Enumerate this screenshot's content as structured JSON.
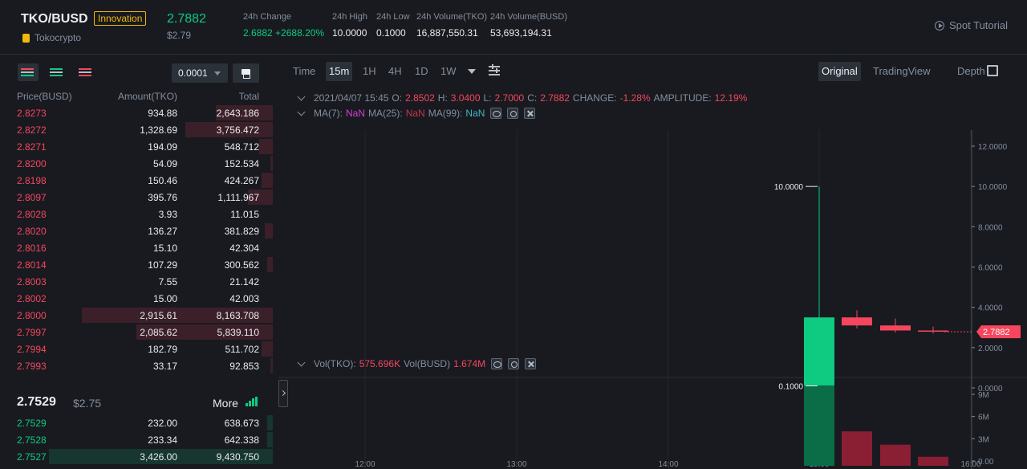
{
  "header": {
    "pair": "TKO/BUSD",
    "badge": "Innovation",
    "brand": "Tokocrypto",
    "last_price": "2.7882",
    "last_price_usd": "$2.79",
    "stats": [
      {
        "label": "24h Change",
        "value": "2.6882 +2688.20%",
        "color": "green"
      },
      {
        "label": "24h High",
        "value": "10.0000"
      },
      {
        "label": "24h Low",
        "value": "0.1000"
      },
      {
        "label": "24h Volume(TKO)",
        "value": "16,887,550.31"
      },
      {
        "label": "24h Volume(BUSD)",
        "value": "53,693,194.31"
      }
    ],
    "tutorial": "Spot Tutorial"
  },
  "orderbook": {
    "tick_size": "0.0001",
    "columns": {
      "price": "Price(BUSD)",
      "amount": "Amount(TKO)",
      "total": "Total"
    },
    "asks": [
      {
        "price": "2.8273",
        "amount": "934.88",
        "total": "2,643.186",
        "depth": 0.21
      },
      {
        "price": "2.8272",
        "amount": "1,328.69",
        "total": "3,756.472",
        "depth": 0.32
      },
      {
        "price": "2.8271",
        "amount": "194.09",
        "total": "548.712",
        "depth": 0.05
      },
      {
        "price": "2.8200",
        "amount": "54.09",
        "total": "152.534",
        "depth": 0.01
      },
      {
        "price": "2.8198",
        "amount": "150.46",
        "total": "424.267",
        "depth": 0.04
      },
      {
        "price": "2.8097",
        "amount": "395.76",
        "total": "1,111.967",
        "depth": 0.09
      },
      {
        "price": "2.8028",
        "amount": "3.93",
        "total": "11.015",
        "depth": 0.0
      },
      {
        "price": "2.8020",
        "amount": "136.27",
        "total": "381.829",
        "depth": 0.03
      },
      {
        "price": "2.8016",
        "amount": "15.10",
        "total": "42.304",
        "depth": 0.0
      },
      {
        "price": "2.8014",
        "amount": "107.29",
        "total": "300.562",
        "depth": 0.02
      },
      {
        "price": "2.8003",
        "amount": "7.55",
        "total": "21.142",
        "depth": 0.0
      },
      {
        "price": "2.8002",
        "amount": "15.00",
        "total": "42.003",
        "depth": 0.0
      },
      {
        "price": "2.8000",
        "amount": "2,915.61",
        "total": "8,163.708",
        "depth": 0.7
      },
      {
        "price": "2.7997",
        "amount": "2,085.62",
        "total": "5,839.110",
        "depth": 0.5
      },
      {
        "price": "2.7994",
        "amount": "182.79",
        "total": "511.702",
        "depth": 0.04
      },
      {
        "price": "2.7993",
        "amount": "33.17",
        "total": "92.853",
        "depth": 0.01
      }
    ],
    "mid_price": "2.7529",
    "mid_price_usd": "$2.75",
    "more": "More",
    "bids": [
      {
        "price": "2.7529",
        "amount": "232.00",
        "total": "638.673",
        "depth": 0.02
      },
      {
        "price": "2.7528",
        "amount": "233.34",
        "total": "642.338",
        "depth": 0.02
      },
      {
        "price": "2.7527",
        "amount": "3,426.00",
        "total": "9,430.750",
        "depth": 0.82
      }
    ]
  },
  "chart_toolbar": {
    "intervals": [
      "Time",
      "15m",
      "1H",
      "4H",
      "1D",
      "1W"
    ],
    "active_interval": "15m",
    "views": [
      "Original",
      "TradingView",
      "Depth"
    ],
    "active_view": "Original"
  },
  "legend": {
    "date": "2021/04/07 15:45",
    "open_label": "O:",
    "open": "2.8502",
    "high_label": "H:",
    "high": "3.0400",
    "low_label": "L:",
    "low": "2.7000",
    "close_label": "C:",
    "close": "2.7882",
    "change_label": "CHANGE:",
    "change": "-1.28%",
    "amplitude_label": "AMPLITUDE:",
    "amplitude": "12.19%",
    "ma7_label": "MA(7):",
    "ma7": "NaN",
    "ma25_label": "MA(25):",
    "ma25": "NaN",
    "ma99_label": "MA(99):",
    "ma99": "NaN",
    "vol_tko_label": "Vol(TKO):",
    "vol_tko": "575.696K",
    "vol_busd_label": "Vol(BUSD)",
    "vol_busd": "1.674M"
  },
  "chart_data": {
    "type": "candlestick",
    "price_axis": {
      "ticks": [
        "12.0000",
        "10.0000",
        "8.0000",
        "6.0000",
        "4.0000",
        "2.0000",
        "0.0000"
      ],
      "range": [
        0,
        12
      ]
    },
    "volume_axis": {
      "ticks": [
        "9M",
        "6M",
        "3M",
        "0.00"
      ],
      "range": [
        0,
        9
      ]
    },
    "time_axis": [
      "12:00",
      "13:00",
      "14:00",
      "15:00",
      "16:00"
    ],
    "current_price": "2.7882",
    "high_marker": "10.0000",
    "low_marker": "0.1000",
    "candles": [
      {
        "time": "15:00",
        "open": 0.1,
        "high": 10.0,
        "low": 0.1,
        "close": 3.5,
        "volume": 10.2,
        "dir": "up"
      },
      {
        "time": "15:15",
        "open": 3.5,
        "high": 3.85,
        "low": 2.95,
        "close": 3.1,
        "volume": 4.0,
        "dir": "down"
      },
      {
        "time": "15:30",
        "open": 3.1,
        "high": 3.45,
        "low": 2.75,
        "close": 2.85,
        "volume": 2.2,
        "dir": "down"
      },
      {
        "time": "15:45",
        "open": 2.8502,
        "high": 3.04,
        "low": 2.7,
        "close": 2.7882,
        "volume": 0.57,
        "dir": "down"
      }
    ]
  },
  "colors": {
    "green": "#0ecb81",
    "red": "#f6465d",
    "bg": "#181a20",
    "panel": "#2b3139"
  }
}
